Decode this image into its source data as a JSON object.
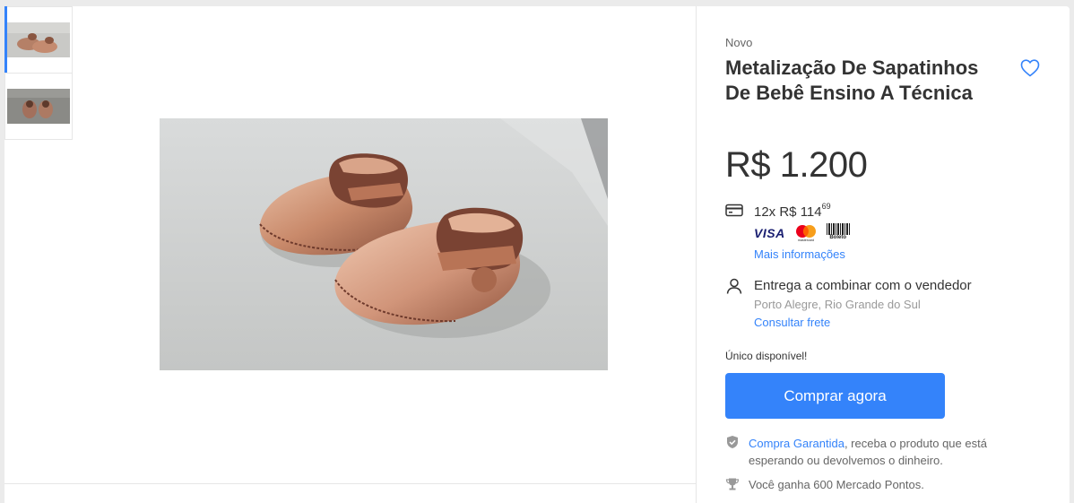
{
  "thumbnails": [
    {
      "alt": "thumbnail-1",
      "active": true
    },
    {
      "alt": "thumbnail-2",
      "active": false
    }
  ],
  "product": {
    "condition": "Novo",
    "title": "Metalização De Sapatinhos De Bebê Ensino A Técnica",
    "price": "R$ 1.200"
  },
  "payment": {
    "installments_prefix": "12x R$ 114",
    "installments_cents": "69",
    "brand_visa": "VISA",
    "brand_mastercard": "mastercard",
    "brand_boleto": "Boleto",
    "more_info": "Mais informações"
  },
  "delivery": {
    "text": "Entrega a combinar com o vendedor",
    "location": "Porto Alegre, Rio Grande do Sul",
    "shipping_link": "Consultar frete"
  },
  "stock": "Único disponível!",
  "buy_button": "Comprar agora",
  "guarantee": {
    "link": "Compra Garantida",
    "text": ", receba o produto que está esperando ou devolvemos o dinheiro."
  },
  "points": "Você ganha 600 Mercado Pontos.",
  "colors": {
    "accent": "#3483fa",
    "background": "#ebebeb",
    "text": "#333333"
  },
  "icons": [
    "credit-card-icon",
    "person-icon",
    "shield-icon",
    "trophy-icon",
    "heart-icon"
  ]
}
